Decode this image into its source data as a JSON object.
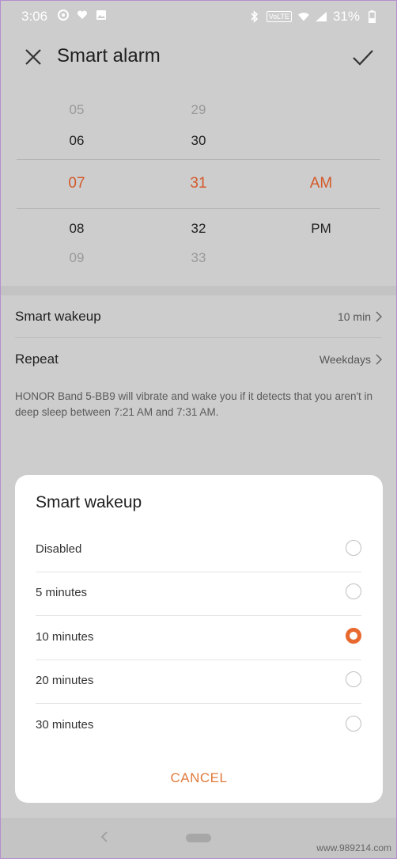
{
  "status_bar": {
    "time": "3:06",
    "volte": "VoLTE",
    "battery": "31%"
  },
  "header": {
    "title": "Smart alarm"
  },
  "picker": {
    "hours": [
      "05",
      "06",
      "07",
      "08",
      "09"
    ],
    "minutes": [
      "29",
      "30",
      "31",
      "32",
      "33"
    ],
    "ampm": [
      "AM",
      "PM"
    ]
  },
  "settings": {
    "smart_wakeup": {
      "label": "Smart wakeup",
      "value": "10 min"
    },
    "repeat": {
      "label": "Repeat",
      "value": "Weekdays"
    },
    "note": "HONOR Band 5-BB9 will vibrate and wake you if it detects that you aren't in deep sleep between 7:21 AM and 7:31 AM."
  },
  "dialog": {
    "title": "Smart wakeup",
    "options": [
      "Disabled",
      "5 minutes",
      "10 minutes",
      "20 minutes",
      "30 minutes"
    ],
    "selected_index": 2,
    "cancel": "CANCEL"
  },
  "watermark": "www.989214.com",
  "colors": {
    "accent": "#e8692f",
    "selected_text": "#d4592a"
  }
}
